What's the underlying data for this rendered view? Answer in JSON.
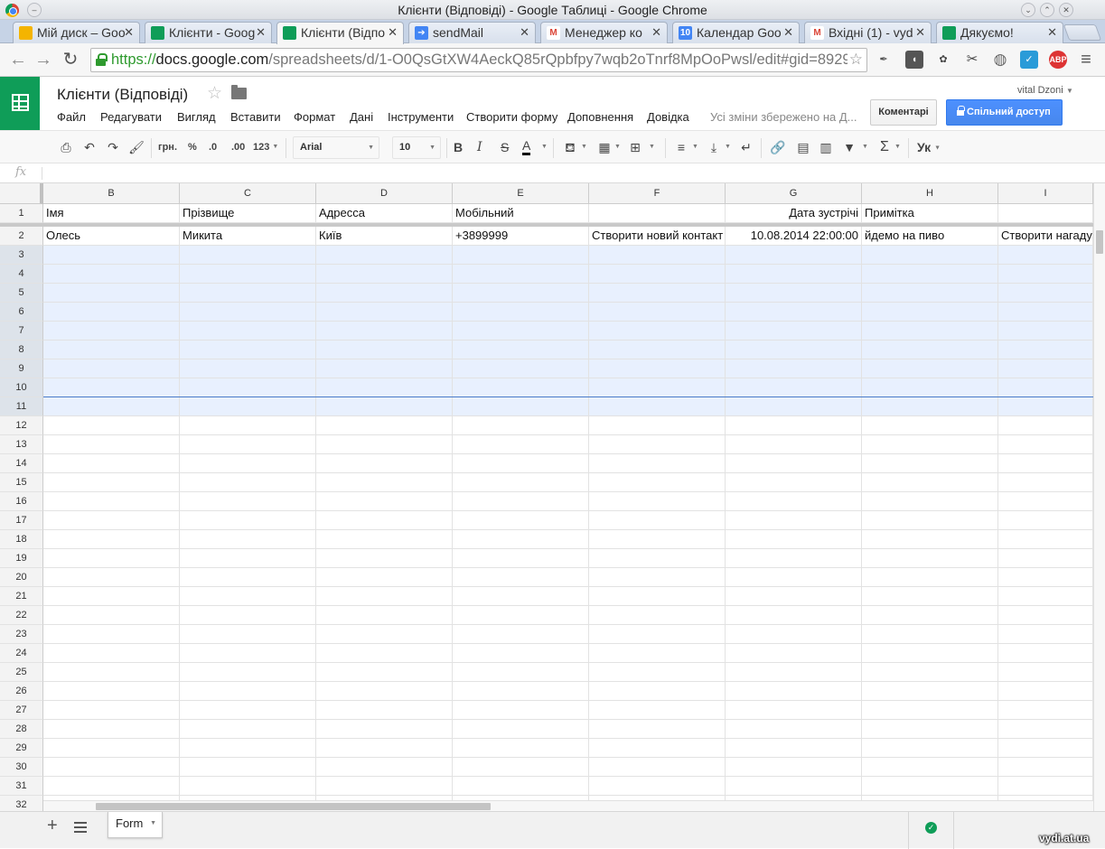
{
  "window": {
    "title": "Клієнти (Відповіді) - Google Таблиці - Google Chrome"
  },
  "tabs": [
    {
      "label": "Мій диск – Goo",
      "icon": "drive-icon",
      "color": "#f4b400"
    },
    {
      "label": "Клієнти - Goog",
      "icon": "sheets-icon",
      "color": "#0f9d58"
    },
    {
      "label": "Клієнти (Відпо",
      "icon": "sheets-icon",
      "color": "#0f9d58"
    },
    {
      "label": "sendMail",
      "icon": "script-icon",
      "color": "#4285f4"
    },
    {
      "label": "Менеджер ко",
      "icon": "gmail-icon",
      "color": "#db4437"
    },
    {
      "label": "Календар Goo",
      "icon": "calendar-icon",
      "color": "#4285f4"
    },
    {
      "label": "Вхідні (1) - vyd",
      "icon": "gmail-icon",
      "color": "#db4437"
    },
    {
      "label": "Дякуємо!",
      "icon": "forms-icon",
      "color": "#0f9d58"
    }
  ],
  "address": {
    "scheme": "https://",
    "host": "docs.google.com",
    "path": "/spreadsheets/d/1-O0QsGtXW4AeckQ85rQpbfpy7wqb2oTnrf8MpOoPwsl/edit#gid=8929"
  },
  "extensions": [
    {
      "name": "ext-feather-icon",
      "glyph": "✒",
      "color": "#555"
    },
    {
      "name": "pocket-icon",
      "glyph": "◖",
      "color": "#555"
    },
    {
      "name": "evernote-icon",
      "glyph": "✿",
      "color": "#444"
    },
    {
      "name": "cut-icon",
      "glyph": "✂",
      "color": "#444"
    },
    {
      "name": "globe-icon",
      "glyph": "◍",
      "color": "#666"
    },
    {
      "name": "check-ext-icon",
      "glyph": "✓",
      "color": "#2a9bd8"
    },
    {
      "name": "adblock-icon",
      "glyph": "ABP",
      "color": "#d33"
    },
    {
      "name": "chrome-menu-icon",
      "glyph": "≡",
      "color": "#555"
    }
  ],
  "doc": {
    "title": "Клієнти (Відповіді)",
    "save_status": "Усі зміни збережено на Д...",
    "user": "vital Dzoni",
    "comments_label": "Коментарі",
    "share_label": "Спільний доступ"
  },
  "menu": [
    "Файл",
    "Редагувати",
    "Вигляд",
    "Вставити",
    "Формат",
    "Дані",
    "Інструменти",
    "Створити форму",
    "Доповнення",
    "Довідка"
  ],
  "toolbar": {
    "currency": "грн.",
    "percent": "%",
    "dec_less": ".0",
    "dec_more": ".00",
    "more_formats": "123",
    "font": "Arial",
    "font_size": "10",
    "bold": "B",
    "italic": "I",
    "strike": "S",
    "text_color": "A",
    "input_tools": "Ук"
  },
  "formula_bar": {
    "label": "fx",
    "value": ""
  },
  "columns": [
    "B",
    "C",
    "D",
    "E",
    "F",
    "G",
    "H",
    "I"
  ],
  "rows": [
    {
      "n": "1",
      "cells": [
        "Імя",
        "Прізвище",
        "Адресса",
        "Мобільний",
        "",
        "Дата зустрічі",
        "Примітка",
        ""
      ]
    },
    {
      "n": "2",
      "cells": [
        "Олесь",
        "Микита",
        "Київ",
        "+3899999",
        "Створити новий контакт",
        "10.08.2014 22:00:00",
        "йдемо на пиво",
        "Створити нагаду"
      ]
    },
    {
      "n": "3",
      "cells": [
        "",
        "",
        "",
        "",
        "",
        "",
        "",
        ""
      ]
    },
    {
      "n": "4",
      "cells": [
        "",
        "",
        "",
        "",
        "",
        "",
        "",
        ""
      ]
    },
    {
      "n": "5",
      "cells": [
        "",
        "",
        "",
        "",
        "",
        "",
        "",
        ""
      ]
    },
    {
      "n": "6",
      "cells": [
        "",
        "",
        "",
        "",
        "",
        "",
        "",
        ""
      ]
    },
    {
      "n": "7",
      "cells": [
        "",
        "",
        "",
        "",
        "",
        "",
        "",
        ""
      ]
    },
    {
      "n": "8",
      "cells": [
        "",
        "",
        "",
        "",
        "",
        "",
        "",
        ""
      ]
    },
    {
      "n": "9",
      "cells": [
        "",
        "",
        "",
        "",
        "",
        "",
        "",
        ""
      ]
    },
    {
      "n": "10",
      "cells": [
        "",
        "",
        "",
        "",
        "",
        "",
        "",
        ""
      ]
    },
    {
      "n": "11",
      "cells": [
        "",
        "",
        "",
        "",
        "",
        "",
        "",
        ""
      ]
    },
    {
      "n": "12",
      "cells": [
        "",
        "",
        "",
        "",
        "",
        "",
        "",
        ""
      ]
    },
    {
      "n": "13",
      "cells": [
        "",
        "",
        "",
        "",
        "",
        "",
        "",
        ""
      ]
    },
    {
      "n": "14",
      "cells": [
        "",
        "",
        "",
        "",
        "",
        "",
        "",
        ""
      ]
    },
    {
      "n": "15",
      "cells": [
        "",
        "",
        "",
        "",
        "",
        "",
        "",
        ""
      ]
    },
    {
      "n": "16",
      "cells": [
        "",
        "",
        "",
        "",
        "",
        "",
        "",
        ""
      ]
    },
    {
      "n": "17",
      "cells": [
        "",
        "",
        "",
        "",
        "",
        "",
        "",
        ""
      ]
    },
    {
      "n": "18",
      "cells": [
        "",
        "",
        "",
        "",
        "",
        "",
        "",
        ""
      ]
    },
    {
      "n": "19",
      "cells": [
        "",
        "",
        "",
        "",
        "",
        "",
        "",
        ""
      ]
    },
    {
      "n": "20",
      "cells": [
        "",
        "",
        "",
        "",
        "",
        "",
        "",
        ""
      ]
    },
    {
      "n": "21",
      "cells": [
        "",
        "",
        "",
        "",
        "",
        "",
        "",
        ""
      ]
    },
    {
      "n": "22",
      "cells": [
        "",
        "",
        "",
        "",
        "",
        "",
        "",
        ""
      ]
    },
    {
      "n": "23",
      "cells": [
        "",
        "",
        "",
        "",
        "",
        "",
        "",
        ""
      ]
    },
    {
      "n": "24",
      "cells": [
        "",
        "",
        "",
        "",
        "",
        "",
        "",
        ""
      ]
    },
    {
      "n": "25",
      "cells": [
        "",
        "",
        "",
        "",
        "",
        "",
        "",
        ""
      ]
    },
    {
      "n": "26",
      "cells": [
        "",
        "",
        "",
        "",
        "",
        "",
        "",
        ""
      ]
    },
    {
      "n": "27",
      "cells": [
        "",
        "",
        "",
        "",
        "",
        "",
        "",
        ""
      ]
    },
    {
      "n": "28",
      "cells": [
        "",
        "",
        "",
        "",
        "",
        "",
        "",
        ""
      ]
    },
    {
      "n": "29",
      "cells": [
        "",
        "",
        "",
        "",
        "",
        "",
        "",
        ""
      ]
    },
    {
      "n": "30",
      "cells": [
        "",
        "",
        "",
        "",
        "",
        "",
        "",
        ""
      ]
    },
    {
      "n": "31",
      "cells": [
        "",
        "",
        "",
        "",
        "",
        "",
        "",
        ""
      ]
    },
    {
      "n": "32",
      "cells": [
        "",
        "",
        "",
        "",
        "",
        "",
        "",
        ""
      ]
    }
  ],
  "selection": {
    "first_row": "3",
    "last_row": "11",
    "color": "#e8f0fe"
  },
  "sheet_tab": {
    "label": "Form"
  },
  "watermark": "vydi.at.ua",
  "colors": {
    "sheets_green": "#0f9d58",
    "share_blue": "#4d90fe",
    "https_green": "#2e9a2e"
  }
}
